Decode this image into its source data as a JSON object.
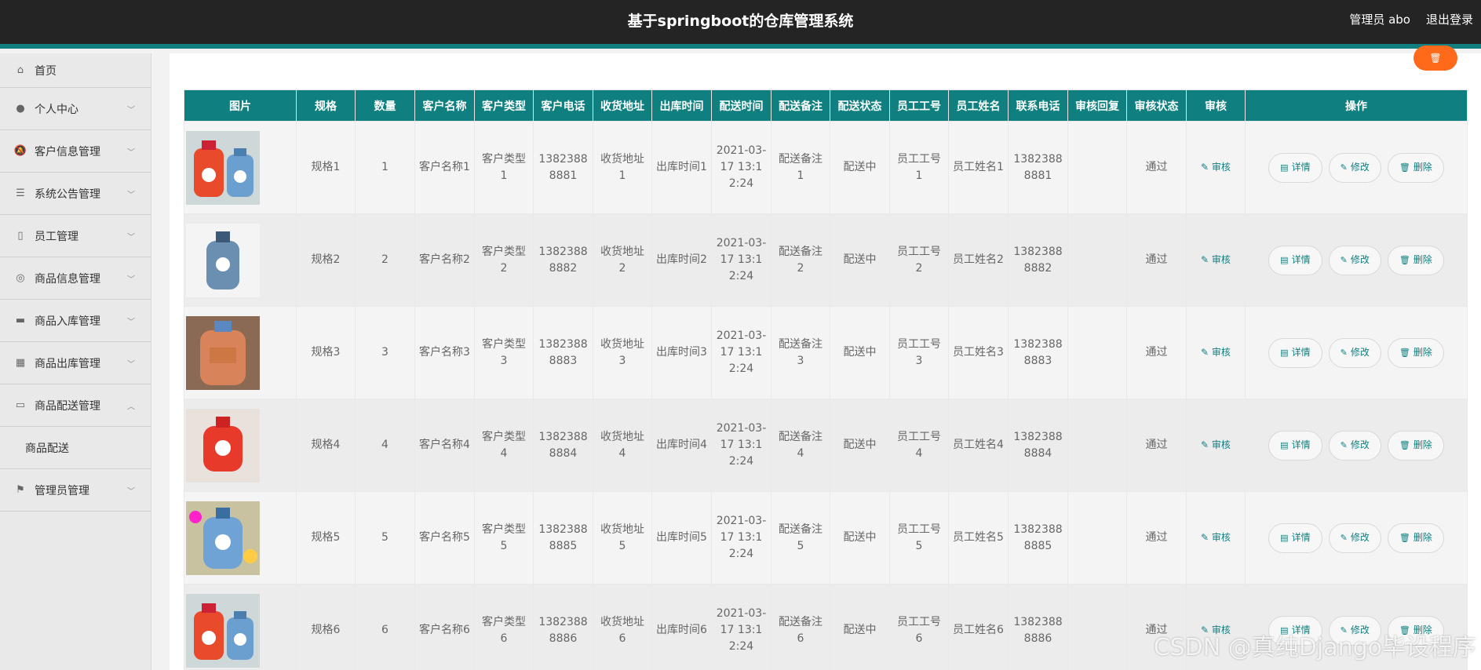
{
  "header": {
    "title": "基于springboot的仓库管理系统",
    "user_label": "管理员 abo",
    "logout_label": "退出登录"
  },
  "sidebar": {
    "items": [
      {
        "label": "首页",
        "icon": "home-icon"
      },
      {
        "label": "个人中心",
        "icon": "user-icon"
      },
      {
        "label": "客户信息管理",
        "icon": "bell-icon"
      },
      {
        "label": "系统公告管理",
        "icon": "list-icon"
      },
      {
        "label": "员工管理",
        "icon": "mic-icon"
      },
      {
        "label": "商品信息管理",
        "icon": "compass-icon"
      },
      {
        "label": "商品入库管理",
        "icon": "briefcase-icon"
      },
      {
        "label": "商品出库管理",
        "icon": "grid-icon"
      },
      {
        "label": "商品配送管理",
        "icon": "card-icon",
        "expanded": true
      },
      {
        "label": "管理员管理",
        "icon": "flag-icon"
      }
    ],
    "submenu": [
      "商品配送"
    ]
  },
  "toolbar": {
    "delete_icon": "trash-icon"
  },
  "table": {
    "headers": [
      "图片",
      "规格",
      "数量",
      "客户名称",
      "客户类型",
      "客户电话",
      "收货地址",
      "出库时间",
      "配送时间",
      "配送备注",
      "配送状态",
      "员工工号",
      "员工姓名",
      "联系电话",
      "审核回复",
      "审核状态",
      "审核",
      "操作"
    ],
    "rows": [
      {
        "spec": "规格1",
        "qty": "1",
        "customer_name": "客户名称1",
        "customer_type": "客户类型1",
        "customer_phone": "13823888881",
        "address": "收货地址1",
        "out_time": "出库时间1",
        "delivery_time": "2021-03-17 13:12:24",
        "delivery_note": "配送备注1",
        "delivery_status": "配送中",
        "emp_no": "员工工号1",
        "emp_name": "员工姓名1",
        "contact_phone": "13823888881",
        "audit_reply": "",
        "audit_status": "通过",
        "image": "gas-cylinder-red-blue"
      },
      {
        "spec": "规格2",
        "qty": "2",
        "customer_name": "客户名称2",
        "customer_type": "客户类型2",
        "customer_phone": "13823888882",
        "address": "收货地址2",
        "out_time": "出库时间2",
        "delivery_time": "2021-03-17 13:12:24",
        "delivery_note": "配送备注2",
        "delivery_status": "配送中",
        "emp_no": "员工工号2",
        "emp_name": "员工姓名2",
        "contact_phone": "13823888882",
        "audit_reply": "",
        "audit_status": "通过",
        "image": "gas-cylinder-blue"
      },
      {
        "spec": "规格3",
        "qty": "3",
        "customer_name": "客户名称3",
        "customer_type": "客户类型3",
        "customer_phone": "13823888883",
        "address": "收货地址3",
        "out_time": "出库时间3",
        "delivery_time": "2021-03-17 13:12:24",
        "delivery_note": "配送备注3",
        "delivery_status": "配送中",
        "emp_no": "员工工号3",
        "emp_name": "员工姓名3",
        "contact_phone": "13823888883",
        "audit_reply": "",
        "audit_status": "通过",
        "image": "gas-cylinder-orange"
      },
      {
        "spec": "规格4",
        "qty": "4",
        "customer_name": "客户名称4",
        "customer_type": "客户类型4",
        "customer_phone": "13823888884",
        "address": "收货地址4",
        "out_time": "出库时间4",
        "delivery_time": "2021-03-17 13:12:24",
        "delivery_note": "配送备注4",
        "delivery_status": "配送中",
        "emp_no": "员工工号4",
        "emp_name": "员工姓名4",
        "contact_phone": "13823888884",
        "audit_reply": "",
        "audit_status": "通过",
        "image": "gas-cylinder-red"
      },
      {
        "spec": "规格5",
        "qty": "5",
        "customer_name": "客户名称5",
        "customer_type": "客户类型5",
        "customer_phone": "13823888885",
        "address": "收货地址5",
        "out_time": "出库时间5",
        "delivery_time": "2021-03-17 13:12:24",
        "delivery_note": "配送备注5",
        "delivery_status": "配送中",
        "emp_no": "员工工号5",
        "emp_name": "员工姓名5",
        "contact_phone": "13823888885",
        "audit_reply": "",
        "audit_status": "通过",
        "image": "gas-cylinder-blue-flowers"
      },
      {
        "spec": "规格6",
        "qty": "6",
        "customer_name": "客户名称6",
        "customer_type": "客户类型6",
        "customer_phone": "13823888886",
        "address": "收货地址6",
        "out_time": "出库时间6",
        "delivery_time": "2021-03-17 13:12:24",
        "delivery_note": "配送备注6",
        "delivery_status": "配送中",
        "emp_no": "员工工号6",
        "emp_name": "员工姓名6",
        "contact_phone": "13823888886",
        "audit_reply": "",
        "audit_status": "通过",
        "image": "gas-cylinder-red-blue"
      }
    ],
    "audit_link": "审核",
    "detail_label": "详情",
    "edit_label": "修改",
    "delete_label": "删除"
  },
  "watermark": "CSDN @真纯Django毕设程序",
  "colors": {
    "header_bg": "#242424",
    "accent": "#0f7f7f",
    "danger": "#ff6a1a"
  }
}
